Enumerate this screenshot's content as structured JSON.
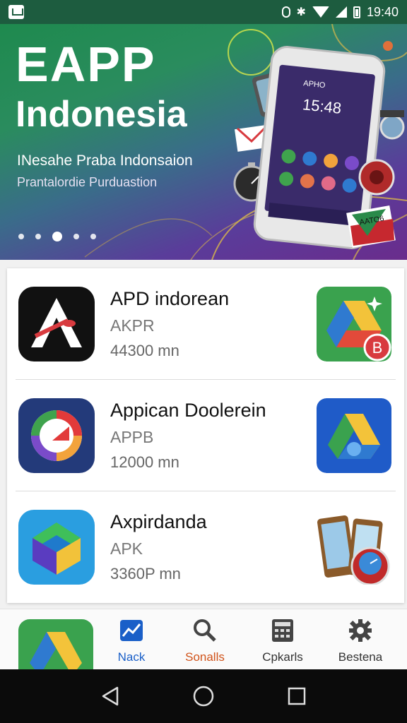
{
  "status_bar": {
    "time": "19:40",
    "icons": [
      "app-notification-icon",
      "nfc-icon",
      "bluetooth-icon",
      "wifi-icon",
      "signal-icon",
      "battery-icon"
    ]
  },
  "hero": {
    "title_line1": "EAPP",
    "title_line2": "Indonesia",
    "subtitle_line1": "INesahe Praba Indonsaion",
    "subtitle_line2": "Prantalordie Purduastion",
    "phone_screen_label": "APHO",
    "phone_time": "15:48",
    "flag_label": "AATO6",
    "carousel_dots": 5,
    "carousel_active_index": 2
  },
  "apps": [
    {
      "name": "APD indorean",
      "sub": "AKPR",
      "size": "44300 mn",
      "icon": "app-a-logo-icon",
      "action_icon": "drive-badge-icon",
      "action_badge": "B"
    },
    {
      "name": "Appican Doolerein",
      "sub": "APPB",
      "size": "12000 mn",
      "icon": "app-ring-logo-icon",
      "action_icon": "drive-triangle-icon"
    },
    {
      "name": "Axpirdanda",
      "sub": "APK",
      "size": "3360P mn",
      "icon": "app-cube-logo-icon",
      "action_icon": "phone-gauge-icon"
    }
  ],
  "tabs": [
    {
      "label": "Nack",
      "icon": "chart-icon",
      "color": "#1a5fc8"
    },
    {
      "label": "Sonalls",
      "icon": "search-icon",
      "color": "#d0531a"
    },
    {
      "label": "Cpkarls",
      "icon": "calculator-icon",
      "color": "#333333"
    },
    {
      "label": "Bestena",
      "icon": "gear-icon",
      "color": "#333333"
    }
  ],
  "nav": [
    "back-icon",
    "home-icon",
    "recents-icon"
  ],
  "colors": {
    "status_bar": "#1d5c3f",
    "accent_blue": "#1a5fc8",
    "accent_orange": "#d0531a",
    "badge_red": "#d83a3f"
  }
}
